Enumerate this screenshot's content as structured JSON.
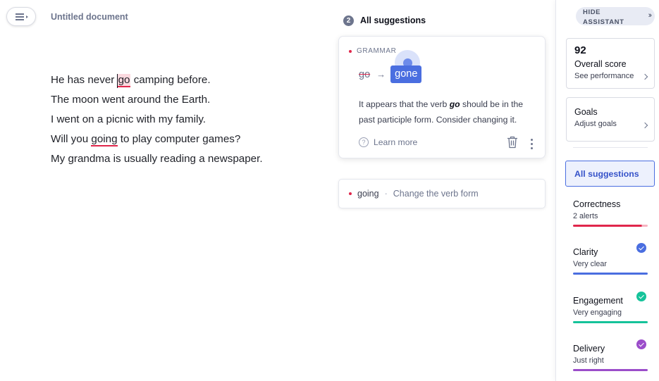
{
  "document": {
    "title": "Untitled document",
    "lines": [
      {
        "before": "He has never ",
        "error": "go",
        "after": " camping before."
      },
      {
        "text": "The moon went around the Earth."
      },
      {
        "text": "I went on a picnic with my family."
      },
      {
        "before": "Will you ",
        "error": "going",
        "after": " to play computer games?"
      },
      {
        "text": "My grandma is usually reading a newspaper."
      }
    ]
  },
  "suggestions": {
    "count": "2",
    "header": "All suggestions",
    "active_card": {
      "category": "GRAMMAR",
      "old_word": "go",
      "new_word": "gone",
      "explanation_before": "It appears that the verb ",
      "explanation_word": "go",
      "explanation_after": " should be in the past participle form. Consider changing it.",
      "learn_more": "Learn more"
    },
    "collapsed_card": {
      "word": "going",
      "separator": "·",
      "description": "Change the verb form"
    }
  },
  "sidebar": {
    "hide_label": "HIDE ASSISTANT",
    "score": {
      "value": "92",
      "title": "Overall score",
      "link": "See performance"
    },
    "goals": {
      "title": "Goals",
      "link": "Adjust goals"
    },
    "all_suggestions": "All suggestions",
    "categories": [
      {
        "name": "Correctness",
        "status": "2 alerts",
        "color": "#e0264b"
      },
      {
        "name": "Clarity",
        "status": "Very clear",
        "color": "#4a6ee0"
      },
      {
        "name": "Engagement",
        "status": "Very engaging",
        "color": "#15c39a"
      },
      {
        "name": "Delivery",
        "status": "Just right",
        "color": "#9b4dca"
      }
    ]
  },
  "colors": {
    "accent": "#4a6ee0",
    "error": "#e0264b"
  }
}
